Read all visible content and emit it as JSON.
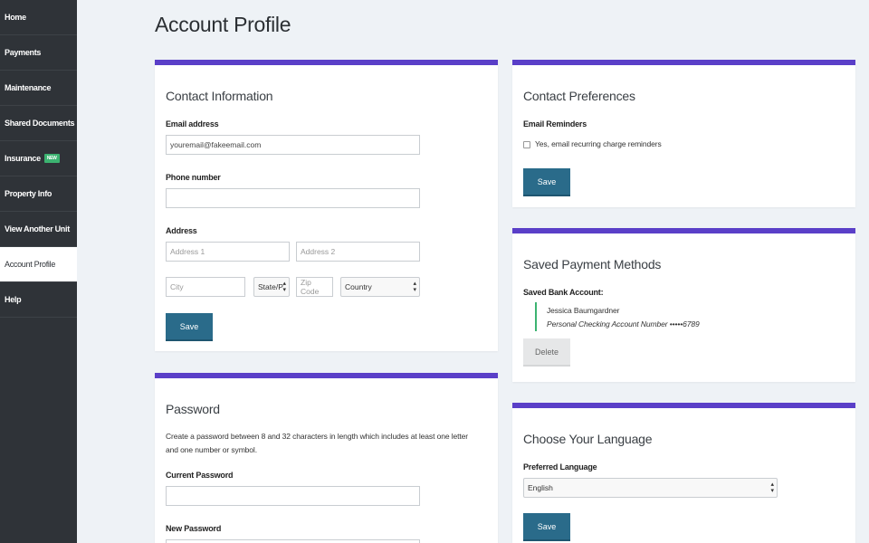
{
  "sidebar": {
    "items": [
      {
        "label": "Home"
      },
      {
        "label": "Payments"
      },
      {
        "label": "Maintenance"
      },
      {
        "label": "Shared Documents"
      },
      {
        "label": "Insurance",
        "badge": "NEW"
      },
      {
        "label": "Property Info"
      },
      {
        "label": "View Another Unit"
      },
      {
        "label": "Account Profile",
        "active": true
      },
      {
        "label": "Help"
      }
    ]
  },
  "page": {
    "title": "Account Profile"
  },
  "contact": {
    "title": "Contact Information",
    "email_label": "Email address",
    "email_value": "youremail@fakeemail.com",
    "phone_label": "Phone number",
    "phone_value": "",
    "address_label": "Address",
    "address1_placeholder": "Address 1",
    "address2_placeholder": "Address 2",
    "city_placeholder": "City",
    "state_value": "State/P",
    "zip_placeholder": "Zip Code",
    "country_value": "Country",
    "save_label": "Save"
  },
  "password": {
    "title": "Password",
    "description": "Create a password between 8 and 32 characters in length which includes at least one letter and one number or symbol.",
    "current_label": "Current Password",
    "new_label": "New Password"
  },
  "preferences": {
    "title": "Contact Preferences",
    "email_reminders_label": "Email Reminders",
    "checkbox_label": "Yes, email recurring charge reminders",
    "checked": false,
    "save_label": "Save"
  },
  "payment_methods": {
    "title": "Saved Payment Methods",
    "bank_label": "Saved Bank Account:",
    "account_name": "Jessica Baumgardner",
    "account_detail": "Personal Checking Account Number •••••6789",
    "delete_label": "Delete"
  },
  "language": {
    "title": "Choose Your Language",
    "label": "Preferred Language",
    "selected": "English",
    "save_label": "Save"
  },
  "colors": {
    "sidebar_bg": "#2f3338",
    "accent_purple": "#5a3fc8",
    "button_blue": "#2a6b8a",
    "badge_green": "#3cb371",
    "page_bg": "#eef2f6"
  }
}
